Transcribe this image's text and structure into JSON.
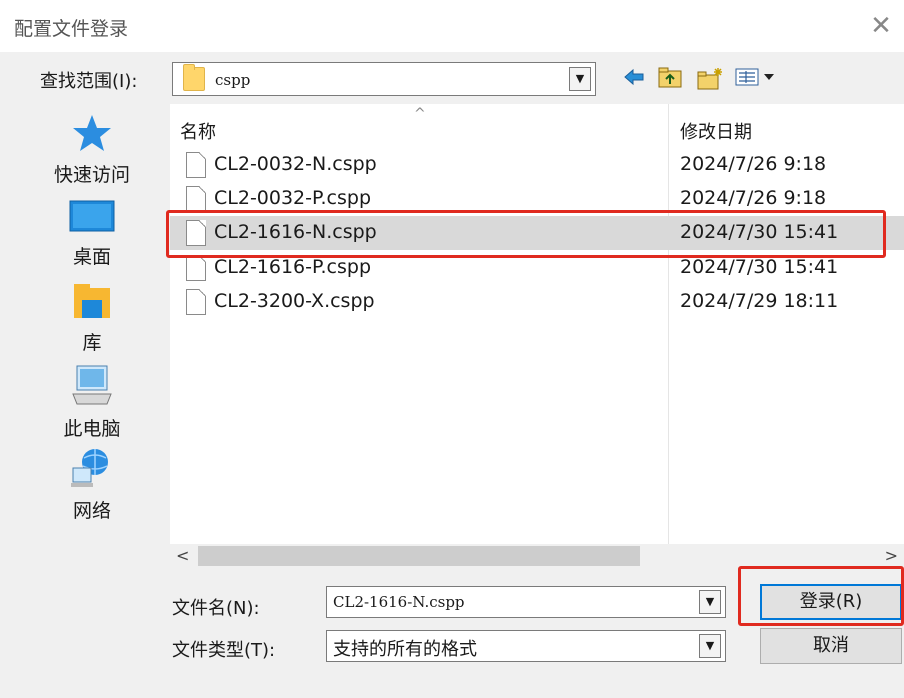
{
  "window": {
    "title": "配置文件登录",
    "close_glyph": "✕"
  },
  "lookin": {
    "label": "查找范围(I):",
    "value": "cspp",
    "toolbar": [
      "back-icon",
      "up-folder-icon",
      "new-folder-icon",
      "view-menu-icon"
    ]
  },
  "places": [
    {
      "label": "快速访问",
      "icon": "star-icon"
    },
    {
      "label": "桌面",
      "icon": "desktop-icon"
    },
    {
      "label": "库",
      "icon": "library-icon"
    },
    {
      "label": "此电脑",
      "icon": "computer-icon"
    },
    {
      "label": "网络",
      "icon": "network-icon"
    }
  ],
  "filelist": {
    "columns": {
      "name": "名称",
      "date": "修改日期"
    },
    "files": [
      {
        "name": "CL2-0032-N.cspp",
        "date": "2024/7/26 9:18",
        "selected": false
      },
      {
        "name": "CL2-0032-P.cspp",
        "date": "2024/7/26 9:18",
        "selected": false
      },
      {
        "name": "CL2-1616-N.cspp",
        "date": "2024/7/30 15:41",
        "selected": true
      },
      {
        "name": "CL2-1616-P.cspp",
        "date": "2024/7/30 15:41",
        "selected": false
      },
      {
        "name": "CL2-3200-X.cspp",
        "date": "2024/7/29 18:11",
        "selected": false
      }
    ]
  },
  "filename": {
    "label": "文件名(N):",
    "value": "CL2-1616-N.cspp"
  },
  "filetype": {
    "label": "文件类型(T):",
    "value": "支持的所有的格式"
  },
  "buttons": {
    "login": "登录(R)",
    "cancel": "取消"
  },
  "colors": {
    "highlight": "#e02a1f",
    "selection": "#d9d9d9"
  }
}
